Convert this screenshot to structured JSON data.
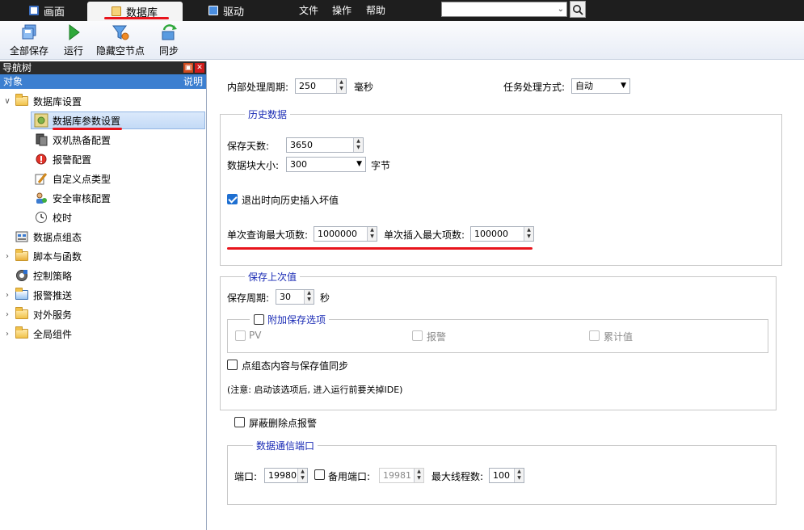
{
  "topbar": {
    "tabs": [
      {
        "label": "画面"
      },
      {
        "label": "数据库"
      },
      {
        "label": "驱动"
      }
    ],
    "menu": [
      "文件",
      "操作",
      "帮助"
    ],
    "search_value": ""
  },
  "toolbar": {
    "save_all": "全部保存",
    "run": "运行",
    "hide_empty": "隐藏空节点",
    "sync": "同步"
  },
  "nav": {
    "title": "导航树",
    "col_object": "对象",
    "col_desc": "说明",
    "items": [
      {
        "label": "数据库设置"
      },
      {
        "label": "数据库参数设置"
      },
      {
        "label": "双机热备配置"
      },
      {
        "label": "报警配置"
      },
      {
        "label": "自定义点类型"
      },
      {
        "label": "安全审核配置"
      },
      {
        "label": "校时"
      },
      {
        "label": "数据点组态"
      },
      {
        "label": "脚本与函数"
      },
      {
        "label": "控制策略"
      },
      {
        "label": "报警推送"
      },
      {
        "label": "对外服务"
      },
      {
        "label": "全局组件"
      }
    ]
  },
  "main": {
    "cycle_label": "内部处理周期:",
    "cycle_value": "250",
    "cycle_unit": "毫秒",
    "task_label": "任务处理方式:",
    "task_value": "自动",
    "history": {
      "title": "历史数据",
      "days_label": "保存天数:",
      "days_value": "3650",
      "block_label": "数据块大小:",
      "block_value": "300",
      "block_unit": "字节",
      "insert_bad_label": "退出时向历史插入坏值",
      "insert_bad_checked": true,
      "query_max_label": "单次查询最大项数:",
      "query_max_value": "1000000",
      "insert_max_label": "单次插入最大项数:",
      "insert_max_value": "100000"
    },
    "last": {
      "title": "保存上次值",
      "period_label": "保存周期:",
      "period_value": "30",
      "period_unit": "秒",
      "extra_title": "附加保存选项",
      "opt_pv": "PV",
      "opt_alarm": "报警",
      "opt_acc": "累计值",
      "sync_label": "点组态内容与保存值同步",
      "note": "(注意: 启动该选项后, 进入运行前要关掉IDE)"
    },
    "shield_label": "屏蔽删除点报警",
    "comm": {
      "title": "数据通信端口",
      "port_label": "端口:",
      "port_value": "19980",
      "backup_label": "备用端口:",
      "backup_value": "19981",
      "threads_label": "最大线程数:",
      "threads_value": "100"
    }
  },
  "colors": {
    "accent": "#3c7fd0",
    "underline_red": "#e8141c",
    "group_title": "#1a2bb5"
  }
}
